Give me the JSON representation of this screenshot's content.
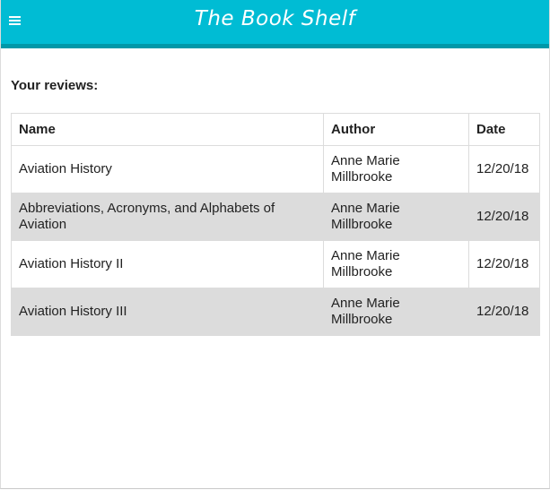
{
  "header": {
    "title": "The Book Shelf",
    "menu_icon": "hamburger-menu-icon"
  },
  "reviews": {
    "label": "Your reviews:",
    "columns": [
      "Name",
      "Author",
      "Date"
    ],
    "rows": [
      {
        "name": "Aviation History",
        "author": "Anne Marie Millbrooke",
        "date": "12/20/18"
      },
      {
        "name": "Abbreviations, Acronyms, and Alphabets of Aviation",
        "author": "Anne Marie Millbrooke",
        "date": "12/20/18"
      },
      {
        "name": "Aviation History II",
        "author": "Anne Marie Millbrooke",
        "date": "12/20/18"
      },
      {
        "name": "Aviation History III",
        "author": "Anne Marie Millbrooke",
        "date": "12/20/18"
      }
    ]
  },
  "colors": {
    "header_bg": "#00bcd4",
    "header_border": "#0098a8",
    "row_stripe": "#dcdcdc"
  }
}
